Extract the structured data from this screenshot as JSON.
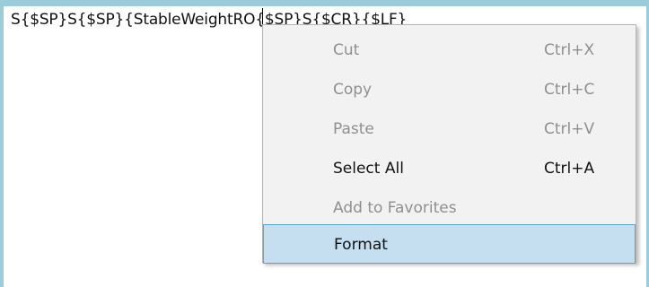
{
  "editor": {
    "text_visible": "S{$SP}S{$SP}{StableWeight",
    "text_partially_hidden": "RO{$SP}S{$CR}{$LF}"
  },
  "context_menu": {
    "items": [
      {
        "label": "Cut",
        "shortcut": "Ctrl+X",
        "enabled": false
      },
      {
        "label": "Copy",
        "shortcut": "Ctrl+C",
        "enabled": false
      },
      {
        "label": "Paste",
        "shortcut": "Ctrl+V",
        "enabled": false
      },
      {
        "label": "Select All",
        "shortcut": "Ctrl+A",
        "enabled": true
      },
      {
        "label": "Add to Favorites",
        "shortcut": "",
        "enabled": false
      },
      {
        "label": "Format",
        "shortcut": "",
        "enabled": true,
        "highlighted": true
      }
    ]
  },
  "colors": {
    "editor_border": "#9ccbd9",
    "menu_background": "#f2f2f2",
    "highlight_background": "#c6dff0",
    "highlight_border": "#5ba2d8",
    "disabled_text": "#8f8f8f"
  }
}
